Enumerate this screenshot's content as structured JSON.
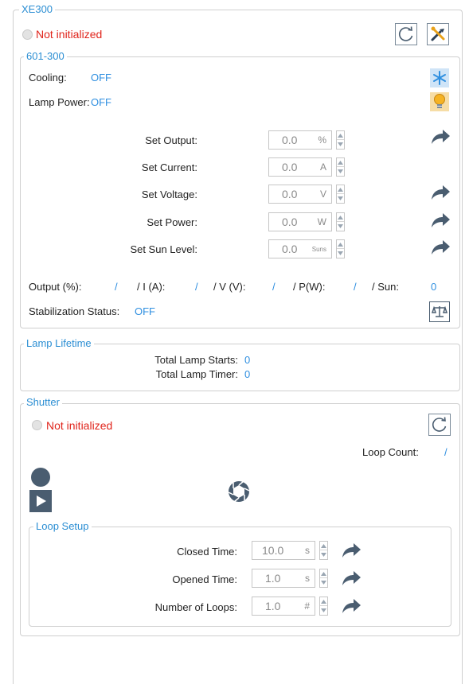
{
  "xe300": {
    "title": "XE300",
    "status": "Not initialized"
  },
  "lamp_601": {
    "title": "601-300",
    "cooling_label": "Cooling:",
    "cooling_value": "OFF",
    "lamp_power_label": "Lamp Power:",
    "lamp_power_value": "OFF",
    "settings": [
      {
        "label": "Set Output:",
        "value": "0.0",
        "unit": "%"
      },
      {
        "label": "Set Current:",
        "value": "0.0",
        "unit": "A"
      },
      {
        "label": "Set Voltage:",
        "value": "0.0",
        "unit": "V"
      },
      {
        "label": "Set Power:",
        "value": "0.0",
        "unit": "W"
      },
      {
        "label": "Set Sun Level:",
        "value": "0.0",
        "unit": "Suns"
      }
    ],
    "readout": {
      "output_label": "Output (%):",
      "output_value": "/",
      "current_label": "/ I (A):",
      "current_value": "/",
      "voltage_label": "/ V (V):",
      "voltage_value": "/",
      "power_label": "/ P(W):",
      "power_value": "/",
      "sun_label": "/ Sun:",
      "sun_value": "0"
    },
    "stabilization_label": "Stabilization Status:",
    "stabilization_value": "OFF"
  },
  "lamp_lifetime": {
    "title": "Lamp Lifetime",
    "starts_label": "Total Lamp Starts:",
    "starts_value": "0",
    "timer_label": "Total Lamp Timer:",
    "timer_value": "0"
  },
  "shutter": {
    "title": "Shutter",
    "status": "Not initialized",
    "loop_count_label": "Loop Count:",
    "loop_count_value": "/"
  },
  "loop_setup": {
    "title": "Loop Setup",
    "rows": [
      {
        "label": "Closed Time:",
        "value": "10.0",
        "unit": "s"
      },
      {
        "label": "Opened Time:",
        "value": "1.0",
        "unit": "s"
      },
      {
        "label": "Number of Loops:",
        "value": "1.0",
        "unit": "#"
      }
    ]
  },
  "colors": {
    "accent": "#2f8fe0",
    "error": "#e0241b",
    "icon_dark": "#4a5d70"
  },
  "icons": {
    "refresh": "refresh-icon",
    "tools": "tools-icon",
    "snowflake": "snowflake-icon",
    "bulb": "light-bulb-icon",
    "apply": "share-arrow-icon",
    "balance": "balance-scale-icon",
    "record": "record-icon",
    "play": "play-icon",
    "shutter": "aperture-icon"
  }
}
